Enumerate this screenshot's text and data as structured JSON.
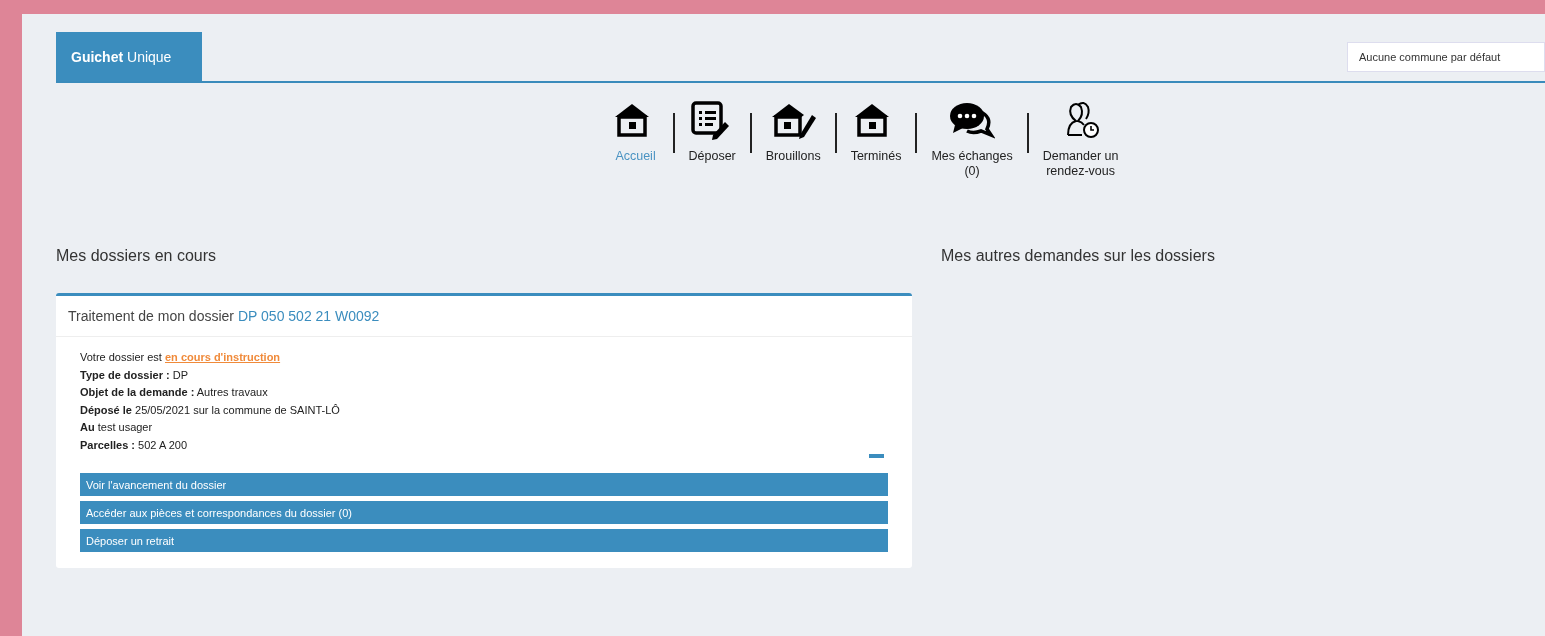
{
  "brand": {
    "bold": "Guichet",
    "rest": "Unique"
  },
  "commune_select": {
    "value": "Aucune commune par défaut"
  },
  "nav": [
    {
      "label": "Accueil",
      "selected": true
    },
    {
      "label": "Déposer",
      "selected": false
    },
    {
      "label": "Brouillons",
      "selected": false
    },
    {
      "label": "Terminés",
      "selected": false
    },
    {
      "label": "Mes échanges\n(0)",
      "selected": false
    },
    {
      "label": "Demander un\nrendez-vous",
      "selected": false
    }
  ],
  "sections": [
    {
      "title": "Mes dossiers en cours"
    },
    {
      "title": "Mes autres demandes sur les dossiers"
    }
  ],
  "card": {
    "title": "Traitement de mon dossier",
    "reference": "DP 050 502 21 W0092",
    "expanded": true,
    "status_prefix": "Votre dossier est",
    "status": "en cours d'instruction",
    "details": [
      "**Type de dossier :** DP",
      "**Objet de la demande :** Autres travaux",
      "**Déposé le** 25/05/2021 sur la commune de SAINT-LÔ",
      "**Au** test usager",
      "**Parcelles :** 502 A 200"
    ],
    "actions": [
      "Voir l'avancement du dossier",
      "Accéder aux pièces et correspondances du dossier (0)",
      "Déposer un retrait"
    ]
  }
}
